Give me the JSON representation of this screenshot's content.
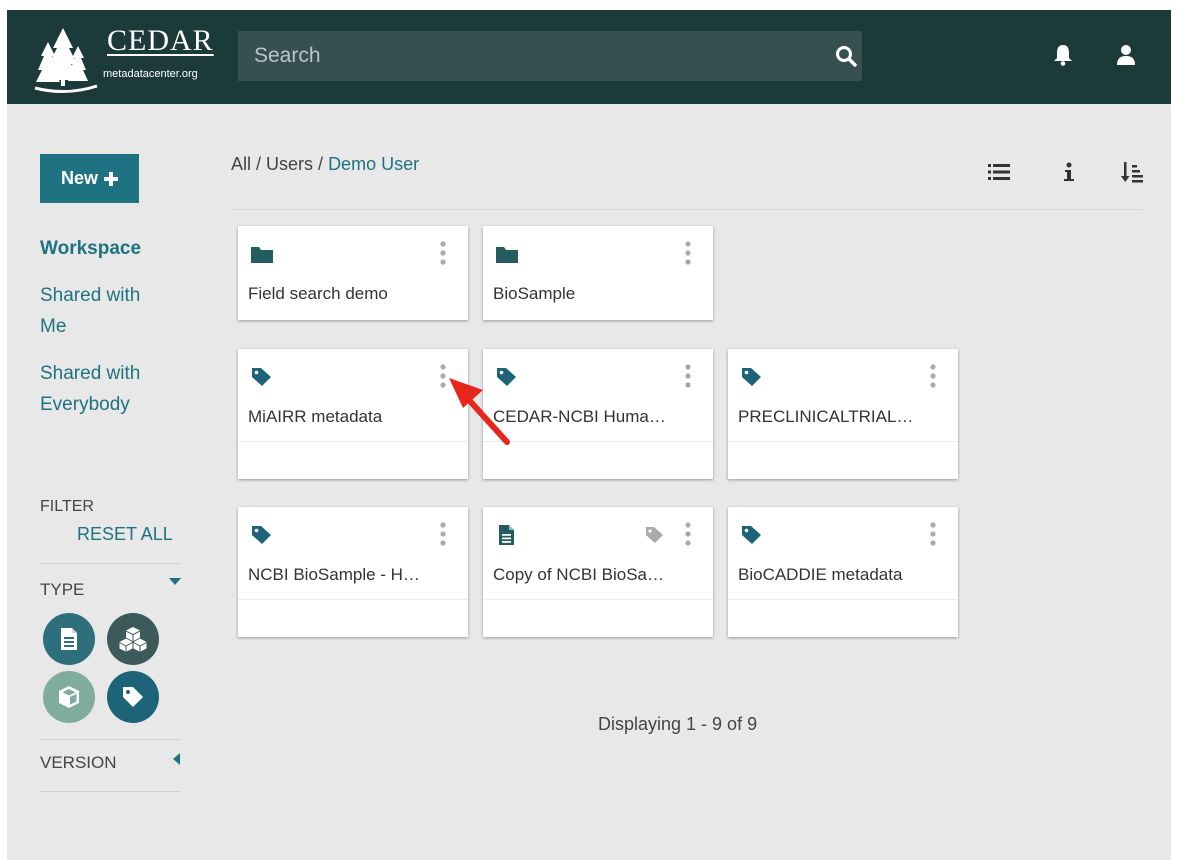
{
  "header": {
    "logo_title": "CEDAR",
    "logo_subtitle": "metadatacenter.org",
    "search_placeholder": "Search"
  },
  "sidebar": {
    "new_label": "New",
    "nav": [
      {
        "label": "Workspace",
        "active": true
      },
      {
        "label": "Shared with Me",
        "active": false
      },
      {
        "label": "Shared with Everybody",
        "active": false
      }
    ],
    "filter_label": "FILTER",
    "reset_all_label": "RESET ALL",
    "type_label": "TYPE",
    "version_label": "VERSION",
    "type_buttons": [
      {
        "name": "template",
        "icon": "document-icon",
        "color": "#2e6f7c",
        "selected": true
      },
      {
        "name": "element",
        "icon": "cubes-icon",
        "color": "#3d5a5a",
        "selected": true
      },
      {
        "name": "field",
        "icon": "cube-icon",
        "color": "#7fac9f",
        "selected": false
      },
      {
        "name": "instance",
        "icon": "tag-icon",
        "color": "#1e6478",
        "selected": true
      }
    ]
  },
  "breadcrumb": {
    "all": "All",
    "users": "Users",
    "current": "Demo User",
    "sep": " / "
  },
  "toolbar": {
    "list_view_icon": "list-icon",
    "info_icon": "info-icon",
    "sort_icon": "sort-icon"
  },
  "folders": [
    {
      "title": "Field search demo",
      "icon": "folder-icon"
    },
    {
      "title": "BioSample",
      "icon": "folder-icon"
    }
  ],
  "items": [
    {
      "title": "MiAIRR metadata",
      "icon": "tag-icon"
    },
    {
      "title": "CEDAR-NCBI Huma…",
      "icon": "tag-icon"
    },
    {
      "title": "PRECLINICALTRIAL…",
      "icon": "tag-icon"
    },
    {
      "title": "NCBI BioSample - H…",
      "icon": "tag-icon"
    },
    {
      "title": "Copy of NCBI BioSa…",
      "icon": "document-icon"
    },
    {
      "title": "BioCADDIE metadata",
      "icon": "tag-icon"
    }
  ],
  "footer": {
    "count_text": "Displaying 1 - 9 of 9"
  },
  "colors": {
    "header_bg": "#1d3a3a",
    "accent": "#1e7281",
    "icon_dark": "#245c60",
    "arrow": "#e8261c"
  }
}
